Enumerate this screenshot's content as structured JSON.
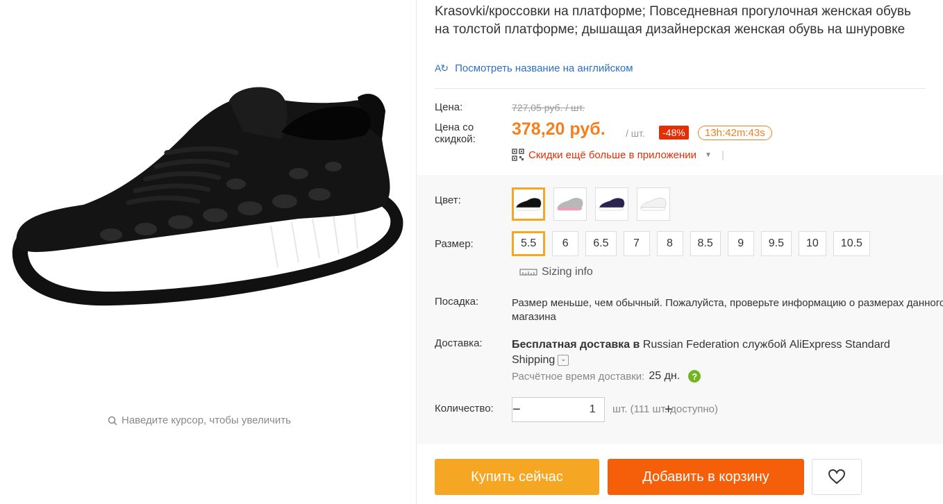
{
  "product": {
    "title": "Krasovki/кроссовки на платформе; Повседневная прогулочная женская обувь на толстой платформе; дышащая дизайнерская женская обувь на шнуровке",
    "translate_link": "Посмотреть название на английском",
    "translate_icon": "translate-icon"
  },
  "gallery": {
    "zoom_hint": "Наведите курсор, чтобы увеличить"
  },
  "pricing": {
    "price_label": "Цена:",
    "old_price": "727,05 руб. / шт.",
    "sale_label": "Цена со скидкой:",
    "sale_price": "378,20 руб.",
    "per_unit": "/ шт.",
    "discount": "-48%",
    "timer": "13h:42m:43s",
    "app_promo": "Скидки ещё больше в приложении",
    "colors": {
      "price": "#f47f1f",
      "discount_bg": "#e62e04"
    }
  },
  "sku": {
    "color_label": "Цвет:",
    "colors": [
      {
        "name": "black",
        "upper": "#111111",
        "sole": "#ffffff"
      },
      {
        "name": "pink-grey",
        "upper": "#b8b8b8",
        "sole": "#f29bb8"
      },
      {
        "name": "navy-purple",
        "upper": "#2a2350",
        "sole": "#ffffff"
      },
      {
        "name": "white",
        "upper": "#f2f2f2",
        "sole": "#ffffff"
      }
    ],
    "selected_color": 0,
    "size_label": "Размер:",
    "sizes": [
      "5.5",
      "6",
      "6.5",
      "7",
      "8",
      "8.5",
      "9",
      "9.5",
      "10",
      "10.5"
    ],
    "selected_size": 0,
    "sizing_info": "Sizing info"
  },
  "fit": {
    "label": "Посадка:",
    "text": "Размер меньше, чем обычный. Пожалуйста, проверьте информацию о размерах данного магазина"
  },
  "shipping": {
    "label": "Доставка:",
    "bold_part": "Бесплатная доставка в",
    "rest": " Russian Federation службой AliExpress Standard Shipping",
    "eta_label": "Расчётное время доставки:",
    "eta_value": "25 дн."
  },
  "quantity": {
    "label": "Количество:",
    "value": "1",
    "minus": "−",
    "plus": "+",
    "available": "шт. (111 шт. доступно)"
  },
  "actions": {
    "buy_now": "Купить сейчас",
    "add_to_cart": "Добавить в корзину",
    "buy_color": "#f5a623",
    "cart_color": "#f55f0a"
  }
}
